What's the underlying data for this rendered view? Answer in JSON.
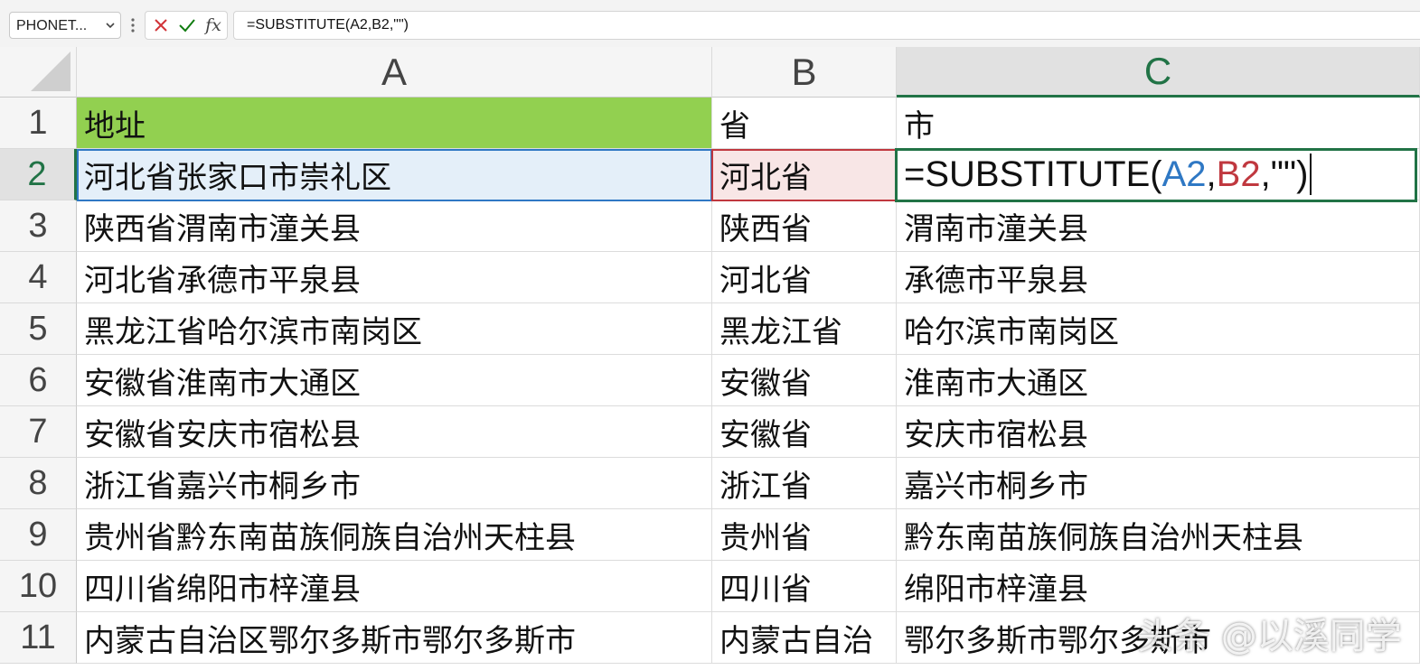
{
  "name_box": {
    "value": "PHONET..."
  },
  "formula_bar": {
    "formula": "=SUBSTITUTE(A2,B2,\"\")"
  },
  "columns": [
    "A",
    "B",
    "C"
  ],
  "row_numbers": [
    "1",
    "2",
    "3",
    "4",
    "5",
    "6",
    "7",
    "8",
    "9",
    "10",
    "11"
  ],
  "rows": [
    {
      "a": "地址",
      "b": "省",
      "c": "市"
    },
    {
      "a": "河北省张家口市崇礼区",
      "b": "河北省",
      "c": ""
    },
    {
      "a": "陕西省渭南市潼关县",
      "b": "陕西省",
      "c": "渭南市潼关县"
    },
    {
      "a": "河北省承德市平泉县",
      "b": "河北省",
      "c": "承德市平泉县"
    },
    {
      "a": "黑龙江省哈尔滨市南岗区",
      "b": "黑龙江省",
      "c": "哈尔滨市南岗区"
    },
    {
      "a": "安徽省淮南市大通区",
      "b": "安徽省",
      "c": "淮南市大通区"
    },
    {
      "a": "安徽省安庆市宿松县",
      "b": "安徽省",
      "c": "安庆市宿松县"
    },
    {
      "a": "浙江省嘉兴市桐乡市",
      "b": "浙江省",
      "c": "嘉兴市桐乡市"
    },
    {
      "a": "贵州省黔东南苗族侗族自治州天柱县",
      "b": "贵州省",
      "c": "黔东南苗族侗族自治州天柱县"
    },
    {
      "a": "四川省绵阳市梓潼县",
      "b": "四川省",
      "c": "绵阳市梓潼县"
    },
    {
      "a": "内蒙古自治区鄂尔多斯市鄂尔多斯市",
      "b": "内蒙古自治",
      "c": "鄂尔多斯市鄂尔多斯市"
    }
  ],
  "edit_cell": {
    "prefix": "=SUBSTITUTE(",
    "ref1": "A2",
    "sep1": ",",
    "ref2": "B2",
    "suffix": ",\"\")"
  },
  "watermark": "头条 @以溪同学",
  "colors": {
    "header_fill": "#92d050",
    "ref_blue": "#2f78c4",
    "ref_red": "#c0383f",
    "selection_green": "#217346"
  },
  "icons": [
    "chevron-down-icon",
    "more-icon",
    "cancel-icon",
    "enter-icon",
    "fx-icon"
  ]
}
